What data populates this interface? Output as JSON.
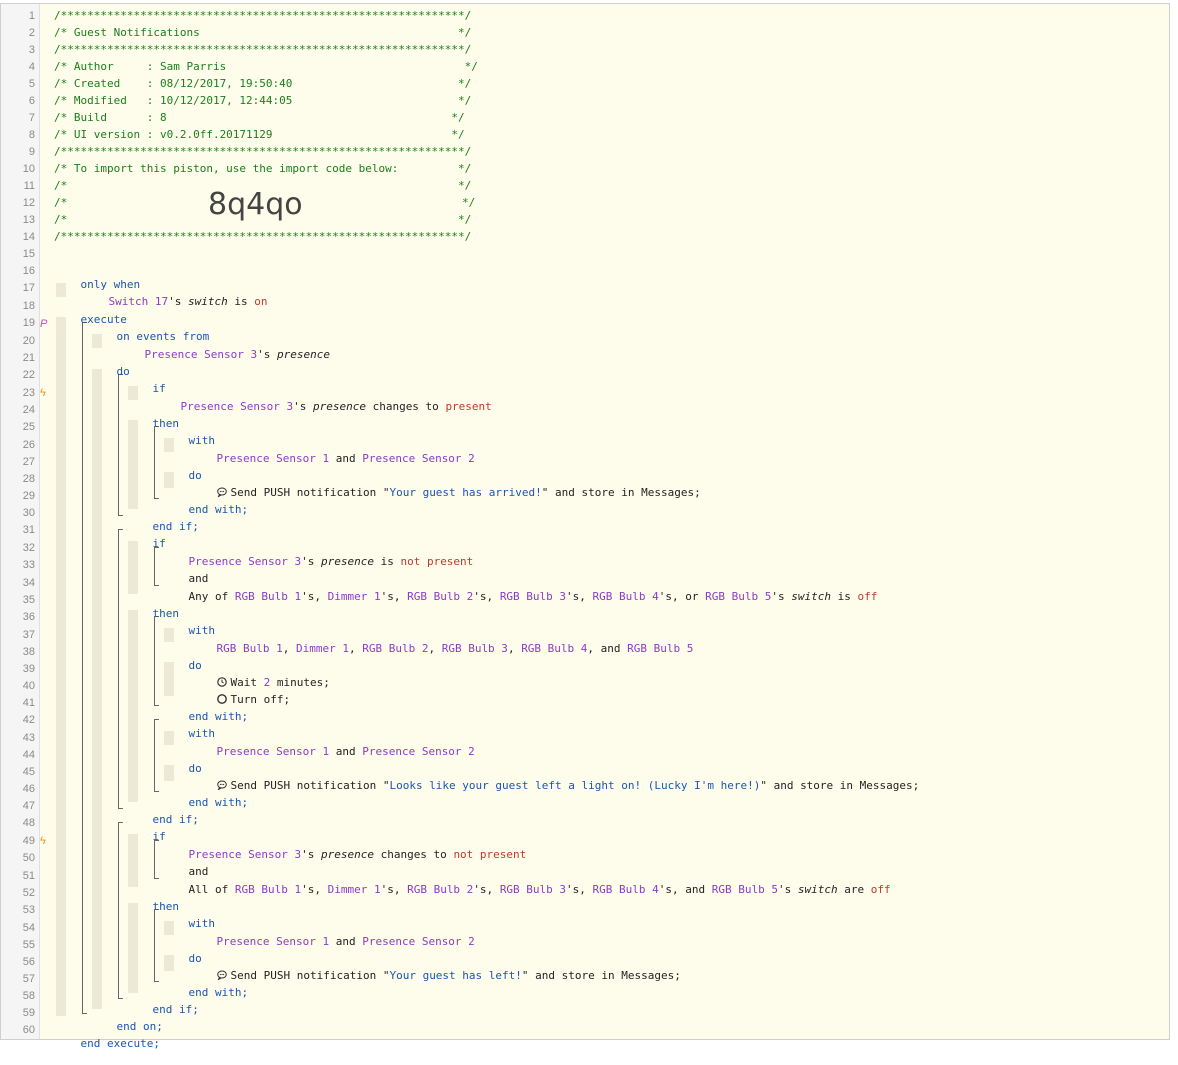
{
  "header": {
    "rule": "/*************************************************************/",
    "title": "/* Guest Notifications                                       */",
    "author": "/* Author     : Sam Parris                                    */",
    "created": "/* Created    : 08/12/2017, 19:50:40                         */",
    "modified": "/* Modified   : 10/12/2017, 12:44:05                         */",
    "build": "/* Build      : 8                                           */",
    "ui_version": "/* UI version : v0.2.0ff.20171129                           */",
    "import_text": "/* To import this piston, use the import code below:         */",
    "blank": "/*                                                           */",
    "blank_left": "/*",
    "blank_right": "*/",
    "import_code": "8q4qo"
  },
  "code": {
    "only_when": "only when",
    "switch17": "Switch 17",
    "s_switch": "'s ",
    "switch_attr": "switch",
    "is": " is ",
    "on_val": "on",
    "execute": "execute",
    "on_events_from": "on events from",
    "presence_sensor_3": "Presence Sensor 3",
    "presence_attr": "presence",
    "do": "do",
    "if": "if",
    "changes_to": " changes to ",
    "present": "present",
    "then": "then",
    "with": "with",
    "presence_sensor_1": "Presence Sensor 1",
    "and_sep": " and ",
    "presence_sensor_2": "Presence Sensor 2",
    "send_push": "Send PUSH notification \"",
    "msg_arrived": "Your guest has arrived!",
    "store_in": "\" and store in Messages;",
    "end_with": "end with;",
    "end_if": "end if;",
    "not_present": "not present",
    "and": "and",
    "any_of": "Any of ",
    "rgb_bulb_1": "RGB Bulb 1",
    "dimmer_1": "Dimmer 1",
    "rgb_bulb_2": "RGB Bulb 2",
    "rgb_bulb_3": "RGB Bulb 3",
    "rgb_bulb_4": "RGB Bulb 4",
    "rgb_bulb_5": "RGB Bulb 5",
    "poss_comma": "'s, ",
    "poss_comma_or": "'s, or ",
    "poss_comma_and": "'s, and ",
    "off_val": "off",
    "comma": ", ",
    "comma_and": ", and ",
    "wait": "Wait ",
    "wait_num": "2",
    "minutes": " minutes;",
    "turn_off": "Turn off;",
    "msg_light": "Looks like your guest left a light on! (Lucky I'm here!)",
    "all_of": "All of ",
    "are": " are ",
    "msg_left": "Your guest has left!",
    "end_on": "end on;",
    "end_execute": "end execute;"
  },
  "gutter": {
    "subscription_mark": "P",
    "trigger_mark": "ϟ"
  }
}
